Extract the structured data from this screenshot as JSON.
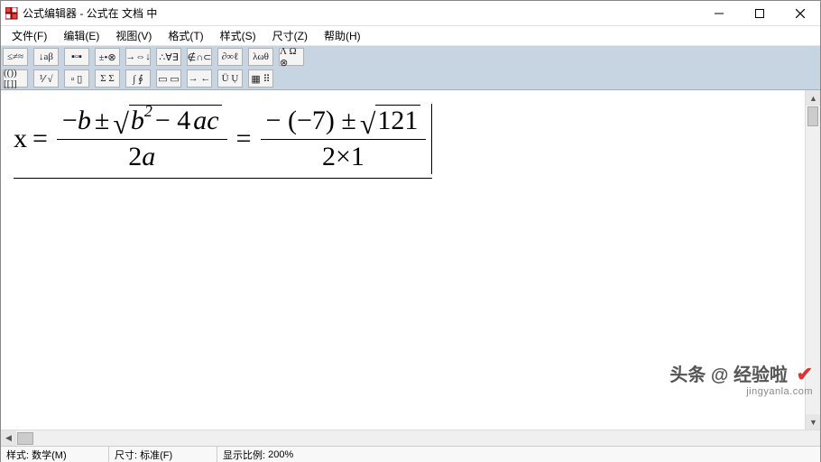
{
  "window": {
    "title": "公式编辑器 - 公式在 文档 中"
  },
  "menu": {
    "items": [
      {
        "label": "文件(F)"
      },
      {
        "label": "编辑(E)"
      },
      {
        "label": "视图(V)"
      },
      {
        "label": "格式(T)"
      },
      {
        "label": "样式(S)"
      },
      {
        "label": "尺寸(Z)"
      },
      {
        "label": "帮助(H)"
      }
    ]
  },
  "toolbar": {
    "row1": [
      "≤≠≈",
      "↓aβ",
      "▪▫▪",
      "±•⊗",
      "→⇔↓",
      "∴∀∃",
      "∉∩⊂",
      "∂∞ℓ",
      "λωθ",
      "Λ Ω ⊗"
    ],
    "row2": [
      "(()) [[]]",
      "⅟ √",
      "▫ ▯",
      "Σ Σ",
      "∫ ∮",
      "▭ ▭",
      "→ ←",
      "Ü Ụ",
      "▦ ⠿"
    ]
  },
  "formula": {
    "lhs_var": "x",
    "eq": "=",
    "frac1": {
      "num_prefix": "−",
      "num_b": "b",
      "num_pm": "±",
      "rad_b": "b",
      "rad_exp": "2",
      "rad_minus": "− 4",
      "rad_a": "a",
      "rad_c": "c",
      "den_two": "2",
      "den_a": "a"
    },
    "frac2": {
      "num_prefix": "− (−7) ±",
      "rad_val": "121",
      "den": "2×1"
    }
  },
  "status": {
    "style_label": "样式:",
    "style_value": "数学(M)",
    "size_label": "尺寸:",
    "size_value": "标准(F)",
    "zoom_label": "显示比例:",
    "zoom_value": "200%"
  },
  "watermark": {
    "line1_a": "头条 @",
    "line1_b": "经验啦",
    "line2": "jingyanla.com"
  }
}
